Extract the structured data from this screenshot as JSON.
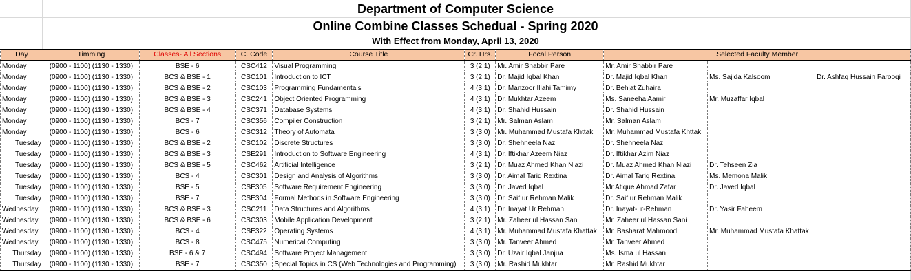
{
  "titles": {
    "department": "Department of Computer Science",
    "schedule": "Online Combine Classes Schedual - Spring 2020",
    "effect": "With Effect from Monday, April 13, 2020"
  },
  "header": {
    "day": "Day",
    "timming": "Timming",
    "classes": "Classes- All Sections",
    "code": "C. Code",
    "title": "Course Title",
    "hrs": "Cr. Hrs.",
    "focal": "Focal Person",
    "faculty": "Selected Faculty Member"
  },
  "colors": {
    "header_bg": "#f7c6a3",
    "classes_header_text": "#e00000"
  },
  "rows": [
    {
      "day": "Monday",
      "time": "(0900 - 1100)   (1130 - 1330)",
      "cls": "BSE - 6",
      "code": "CSC412",
      "title": "Visual Programming",
      "hrs": "3 (2 1)",
      "focal": "Mr. Amir Shabbir Pare",
      "f1": "Mr. Amir Shabbir Pare",
      "f2": "",
      "f3": ""
    },
    {
      "day": "Monday",
      "time": "(0900 - 1100)   (1130 - 1330)",
      "cls": "BCS & BSE - 1",
      "code": "CSC101",
      "title": "Introduction to ICT",
      "hrs": "3 (2 1)",
      "focal": "Dr. Majid Iqbal Khan",
      "f1": "Dr. Majid Iqbal Khan",
      "f2": "Ms. Sajida Kalsoom",
      "f3": "Dr. Ashfaq Hussain Farooqi"
    },
    {
      "day": "Monday",
      "time": "(0900 - 1100)   (1130 - 1330)",
      "cls": "BCS & BSE - 2",
      "code": "CSC103",
      "title": "Programming Fundamentals",
      "hrs": "4 (3 1)",
      "focal": "Dr. Manzoor Illahi Tamimy",
      "f1": "Dr. Behjat Zuhaira",
      "f2": "",
      "f3": ""
    },
    {
      "day": "Monday",
      "time": "(0900 - 1100)   (1130 - 1330)",
      "cls": "BCS & BSE - 3",
      "code": "CSC241",
      "title": "Object Oriented Programming",
      "hrs": "4 (3 1)",
      "focal": "Dr. Mukhtar Azeem",
      "f1": "Ms. Saneeha Aamir",
      "f2": "Mr. Muzaffar Iqbal",
      "f3": ""
    },
    {
      "day": "Monday",
      "time": "(0900 - 1100)   (1130 - 1330)",
      "cls": "BCS & BSE - 4",
      "code": "CSC371",
      "title": "Database Systems I",
      "hrs": "4 (3 1)",
      "focal": "Dr. Shahid Hussain",
      "f1": "Dr. Shahid Hussain",
      "f2": "",
      "f3": ""
    },
    {
      "day": "Monday",
      "time": "(0900 - 1100)   (1130 - 1330)",
      "cls": "BCS - 7",
      "code": "CSC356",
      "title": "Compiler Construction",
      "hrs": "3 (2 1)",
      "focal": "Mr. Salman Aslam",
      "f1": "Mr. Salman Aslam",
      "f2": "",
      "f3": ""
    },
    {
      "day": "Monday",
      "time": "(0900 - 1100)   (1130 - 1330)",
      "cls": "BCS - 6",
      "code": "CSC312",
      "title": "Theory of Automata",
      "hrs": "3 (3 0)",
      "focal": "Mr. Muhammad Mustafa Khttak",
      "f1": "Mr. Muhammad Mustafa Khttak",
      "f2": "",
      "f3": ""
    },
    {
      "day": "Tuesday",
      "time": "(0900 - 1100)   (1130 - 1330)",
      "cls": "BCS & BSE - 2",
      "code": "CSC102",
      "title": "Discrete Structures",
      "hrs": "3 (3 0)",
      "focal": "Dr. Shehneela Naz",
      "f1": "Dr. Shehneela Naz",
      "f2": "",
      "f3": ""
    },
    {
      "day": "Tuesday",
      "time": "(0900 - 1100)   (1130 - 1330)",
      "cls": "BCS & BSE - 3",
      "code": "CSE291",
      "title": "Introduction to Software Engineering",
      "hrs": "4 (3 1)",
      "focal": "Dr. Iftikhar Azeem Niaz",
      "f1": "Dr. Iftikhar Azim Niaz",
      "f2": "",
      "f3": ""
    },
    {
      "day": "Tuesday",
      "time": "(0900 - 1100)   (1130 - 1330)",
      "cls": "BCS & BSE - 5",
      "code": "CSC462",
      "title": "Artificial Intelligence",
      "hrs": "3 (2 1)",
      "focal": "Dr. Muaz Ahmed Khan Niazi",
      "f1": "Dr. Muaz Ahmed Khan Niazi",
      "f2": "Dr. Tehseen Zia",
      "f3": ""
    },
    {
      "day": "Tuesday",
      "time": "(0900 - 1100)   (1130 - 1330)",
      "cls": "BCS - 4",
      "code": "CSC301",
      "title": "Design and Analysis of Algorithms",
      "hrs": "3 (3 0)",
      "focal": "Dr. Aimal Tariq Rextina",
      "f1": "Dr. Aimal Tariq Rextina",
      "f2": "Ms. Memona Malik",
      "f3": ""
    },
    {
      "day": "Tuesday",
      "time": "(0900 - 1100)   (1130 - 1330)",
      "cls": "BSE - 5",
      "code": "CSE305",
      "title": "Software Requirement Engineering",
      "hrs": "3 (3 0)",
      "focal": "Dr. Javed Iqbal",
      "f1": "Mr.Atique Ahmad Zafar",
      "f2": "Dr. Javed Iqbal",
      "f3": ""
    },
    {
      "day": "Tuesday",
      "time": "(0900 - 1100)   (1130 - 1330)",
      "cls": "BSE - 7",
      "code": "CSE304",
      "title": "Formal Methods in Software Engineering",
      "hrs": "3 (3 0)",
      "focal": "Dr. Saif ur Rehman Malik",
      "f1": "Dr. Saif ur Rehman Malik",
      "f2": "",
      "f3": ""
    },
    {
      "day": "Wednesday",
      "time": "(0900 - 1100)   (1130 - 1330)",
      "cls": "BCS & BSE - 3",
      "code": "CSC211",
      "title": "Data Structures and Algorithms",
      "hrs": "4 (3 1)",
      "focal": "Dr. Inayat Ur Rehman",
      "f1": "Dr. Inayat-ur-Rehman",
      "f2": "Dr. Yasir Faheem",
      "f3": ""
    },
    {
      "day": "Wednesday",
      "time": "(0900 - 1100)   (1130 - 1330)",
      "cls": "BCS & BSE - 6",
      "code": "CSC303",
      "title": "Mobile Application Development",
      "hrs": "3 (2 1)",
      "focal": "Mr. Zaheer ul Hassan Sani",
      "f1": "Mr. Zaheer ul Hassan Sani",
      "f2": "",
      "f3": ""
    },
    {
      "day": "Wednesday",
      "time": "(0900 - 1100)   (1130 - 1330)",
      "cls": "BCS - 4",
      "code": "CSE322",
      "title": "Operating Systems",
      "hrs": "4 (3 1)",
      "focal": "Mr. Muhammad Mustafa Khattak",
      "f1": "Mr. Basharat Mahmood",
      "f2": "Mr. Muhammad Mustafa Khattak",
      "f3": ""
    },
    {
      "day": "Wednesday",
      "time": "(0900 - 1100)   (1130 - 1330)",
      "cls": "BCS - 8",
      "code": "CSC475",
      "title": "Numerical Computing",
      "hrs": "3 (3 0)",
      "focal": "Mr. Tanveer Ahmed",
      "f1": "Mr. Tanveer Ahmed",
      "f2": "",
      "f3": ""
    },
    {
      "day": "Thursday",
      "time": "(0900 - 1100)   (1130 - 1330)",
      "cls": "BSE - 6 & 7",
      "code": "CSC494",
      "title": "Software Project Management",
      "hrs": "3 (3 0)",
      "focal": "Dr. Uzair Iqbal Janjua",
      "f1": "Ms. Isma ul Hassan",
      "f2": "",
      "f3": ""
    },
    {
      "day": "Thursday",
      "time": "(0900 - 1100)   (1130 - 1330)",
      "cls": "BSE - 7",
      "code": "CSC350",
      "title": "Special Topics in CS (Web Technologies and Programming)",
      "hrs": "3 (3 0)",
      "focal": "Mr. Rashid Mukhtar",
      "f1": "Mr. Rashid Mukhtar",
      "f2": "",
      "f3": ""
    }
  ]
}
